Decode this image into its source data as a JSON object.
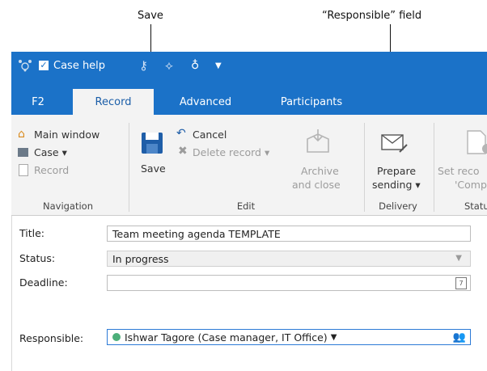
{
  "callouts": {
    "save": "Save",
    "responsible": "“Responsible” field"
  },
  "titlebar": {
    "case_help": "Case help"
  },
  "tabs": [
    {
      "label": "F2"
    },
    {
      "label": "Record"
    },
    {
      "label": "Advanced"
    },
    {
      "label": "Participants"
    }
  ],
  "ribbon": {
    "navigation": {
      "main_window": "Main window",
      "case": "Case ▾",
      "record": "Record",
      "group": "Navigation"
    },
    "edit": {
      "save": "Save",
      "cancel": "Cancel",
      "delete_record": "Delete record ▾",
      "archive_line1": "Archive",
      "archive_line2": "and close",
      "group": "Edit"
    },
    "delivery": {
      "prepare_line1": "Prepare",
      "prepare_line2": "sending ▾",
      "group": "Delivery"
    },
    "status": {
      "set_line1": "Set reco",
      "set_line2": "'Compl",
      "group": "Statu"
    }
  },
  "form": {
    "title_label": "Title:",
    "title_value": "Team meeting agenda TEMPLATE",
    "status_label": "Status:",
    "status_value": "In progress",
    "deadline_label": "Deadline:",
    "deadline_value": "",
    "responsible_label": "Responsible:",
    "responsible_value": "Ishwar Tagore (Case manager, IT Office)"
  },
  "colors": {
    "accent": "#1b72c8",
    "status_dot": "#4caf7a"
  }
}
